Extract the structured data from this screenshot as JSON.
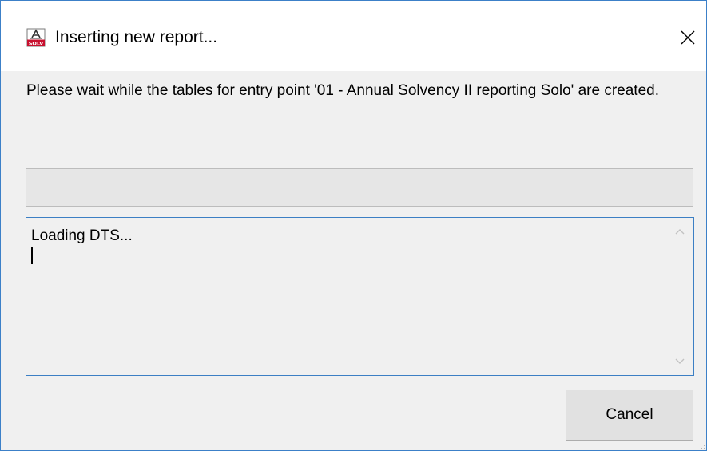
{
  "window": {
    "title": "Inserting new report...",
    "app_icon": "solvency-ii-app-icon",
    "close_icon": "close-icon"
  },
  "message": "Please wait while the tables for entry point '01 - Annual Solvency II reporting Solo' are created.",
  "progress": {
    "value": 0
  },
  "log": {
    "text": "Loading DTS...",
    "scroll_up_icon": "chevron-up-icon",
    "scroll_down_icon": "chevron-down-icon"
  },
  "buttons": {
    "cancel_label": "Cancel"
  },
  "colors": {
    "window_border": "#3c80c8",
    "log_border": "#3c7fc4",
    "background": "#f0f0f0",
    "icon_accent": "#c8102e"
  }
}
